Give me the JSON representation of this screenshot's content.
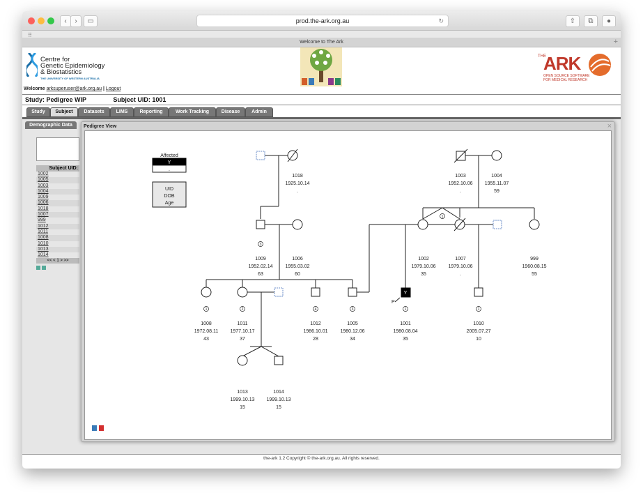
{
  "browser": {
    "url": "prod.the-ark.org.au",
    "tab_title": "Welcome to The Ark"
  },
  "header": {
    "org_line1": "Centre for",
    "org_line2": "Genetic Epidemiology",
    "org_line3": "& Biostatistics",
    "org_sub": "THE UNIVERSITY OF WESTERN AUSTRALIA",
    "ark_prefix": "THE",
    "ark_title": "ARK",
    "ark_sub1": "OPEN SOURCE SOFTWARE",
    "ark_sub2": "FOR MEDICAL RESEARCH"
  },
  "welcome": {
    "prefix": "Welcome",
    "user": "arksuperuser@ark.org.au",
    "sep": "|",
    "logout": "Logout"
  },
  "study": {
    "label": "Study: Pedigree WIP",
    "subject": "Subject UID: 1001"
  },
  "nav_tabs": [
    "Study",
    "Subject",
    "Datasets",
    "LIMS",
    "Reporting",
    "Work Tracking",
    "Disease",
    "Admin"
  ],
  "sub_tab": "Demographic Data",
  "subject_table": {
    "header": "Subject UID:",
    "rows": [
      "1002",
      "1005",
      "1003",
      "1004",
      "1009",
      "1006",
      "1018",
      "1007",
      "999",
      "1012",
      "1011",
      "1008",
      "1010",
      "1013",
      "1014"
    ],
    "pager": "<< < 1 > >>"
  },
  "modal": {
    "title": "Pedigree View",
    "close": "×"
  },
  "legend": {
    "affected": "Affected",
    "y": "Y",
    "n": ".",
    "uid": "UID",
    "dob": "DOB",
    "age": "Age"
  },
  "pedigree": {
    "p1018": {
      "uid": "1018",
      "dob": "1925.10.14",
      "age": "."
    },
    "p1003": {
      "uid": "1003",
      "dob": "1952.10.06",
      "age": "."
    },
    "p1004": {
      "uid": "1004",
      "dob": "1955.11.07",
      "age": "59"
    },
    "p1009": {
      "uid": "1009",
      "dob": "1952.02.14",
      "age": "63",
      "num": "3"
    },
    "p1006": {
      "uid": "1006",
      "dob": "1955.03.02",
      "age": "60"
    },
    "p1002": {
      "uid": "1002",
      "dob": "1979.10.06",
      "age": "35"
    },
    "p1007": {
      "uid": "1007",
      "dob": "1979.10.06",
      "age": "."
    },
    "p999": {
      "uid": "999",
      "dob": "1960.08.15",
      "age": "55"
    },
    "p1008": {
      "uid": "1008",
      "dob": "1972.08.11",
      "age": "43",
      "num": "1"
    },
    "p1011": {
      "uid": "1011",
      "dob": "1977.10.17",
      "age": "37",
      "num": "2"
    },
    "p1012": {
      "uid": "1012",
      "dob": "1986.10.01",
      "age": "28",
      "num": "4"
    },
    "p1005": {
      "uid": "1005",
      "dob": "1980.12.06",
      "age": "34",
      "num": "3"
    },
    "p1001": {
      "uid": "1001",
      "dob": "1980.08.04",
      "age": "35",
      "num": "1",
      "affected": "Y",
      "proband": "P"
    },
    "p1010": {
      "uid": "1010",
      "dob": "2005.07.27",
      "age": "10",
      "num": "1"
    },
    "p1013": {
      "uid": "1013",
      "dob": "1999.10.13",
      "age": "15"
    },
    "p1014": {
      "uid": "1014",
      "dob": "1999.10.13",
      "age": "15"
    },
    "sibship_num": "1"
  },
  "footer": "the-ark 1.2 Copyright © the-ark.org.au. All rights reserved.",
  "colors": {
    "nav_tab": "#777777",
    "affected_fill": "#000000",
    "ark_red": "#c0392b"
  }
}
